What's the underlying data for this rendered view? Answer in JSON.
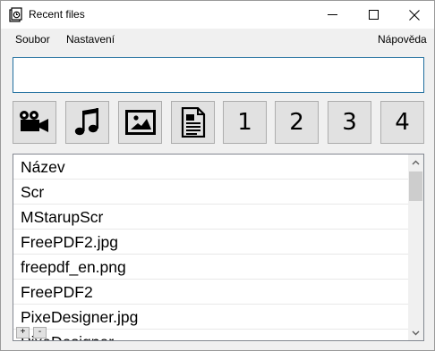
{
  "window": {
    "title": "Recent files"
  },
  "menu": {
    "file": "Soubor",
    "settings": "Nastavení",
    "help": "Nápověda"
  },
  "search": {
    "value": "",
    "placeholder": ""
  },
  "filters": {
    "video_icon": "video-camera",
    "music_icon": "music-note",
    "image_icon": "picture",
    "document_icon": "document",
    "slot1": "1",
    "slot2": "2",
    "slot3": "3",
    "slot4": "4"
  },
  "list": {
    "items": [
      "Název",
      "Scr",
      "MStarupScr",
      "FreePDF2.jpg",
      "freepdf_en.png",
      "FreePDF2",
      "PixeDesigner.jpg",
      "PixeDesigner"
    ],
    "add_label": "+",
    "remove_label": "-"
  },
  "colors": {
    "accent_border": "#1f6e9e",
    "button_face": "#e1e1e1"
  }
}
